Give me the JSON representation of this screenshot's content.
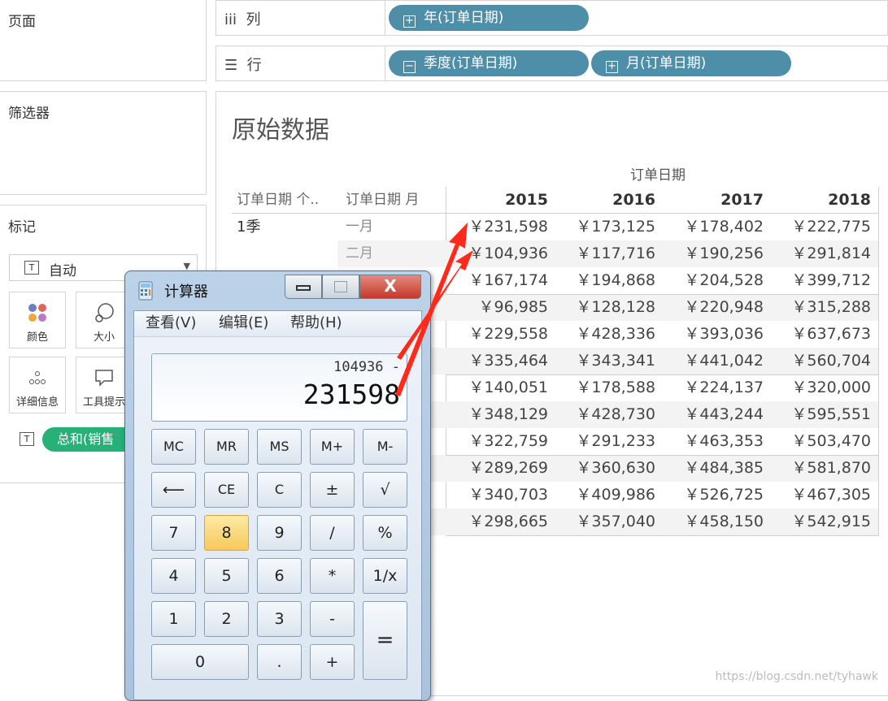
{
  "left": {
    "pages_title": "页面",
    "filters_title": "筛选器",
    "marks": {
      "title": "标记",
      "type_select": "自动",
      "cards": [
        {
          "label": "颜色",
          "icon": "color-dots-icon"
        },
        {
          "label": "大小",
          "icon": "size-icon"
        },
        {
          "label": "详细信息",
          "icon": "detail-icon"
        },
        {
          "label": "工具提示",
          "icon": "tooltip-icon"
        }
      ],
      "pill": "总和(销售",
      "pill_color": "#27b078"
    }
  },
  "shelves": {
    "columns": {
      "label": "列",
      "pills": [
        "年(订单日期)"
      ]
    },
    "rows": {
      "label": "行",
      "pills": [
        "季度(订单日期)",
        "月(订单日期)"
      ]
    },
    "pill_color": "#4e8ea8"
  },
  "sheet": {
    "title": "原始数据",
    "col_group_header": "订单日期",
    "row_headers": [
      "订单日期 个..",
      "订单日期 月"
    ],
    "years": [
      "2015",
      "2016",
      "2017",
      "2018"
    ],
    "quarter_label": "1季",
    "months": [
      "一月",
      "二月"
    ],
    "rows": [
      [
        "￥231,598",
        "￥173,125",
        "￥178,402",
        "￥222,775"
      ],
      [
        "￥104,936",
        "￥117,716",
        "￥190,256",
        "￥291,814"
      ],
      [
        "￥167,174",
        "￥194,868",
        "￥204,528",
        "￥399,712"
      ],
      [
        "￥96,985",
        "￥128,128",
        "￥220,948",
        "￥315,288"
      ],
      [
        "￥229,558",
        "￥428,336",
        "￥393,036",
        "￥637,673"
      ],
      [
        "￥335,464",
        "￥343,341",
        "￥441,042",
        "￥560,704"
      ],
      [
        "￥140,051",
        "￥178,588",
        "￥224,137",
        "￥320,000"
      ],
      [
        "￥348,129",
        "￥428,730",
        "￥443,244",
        "￥595,551"
      ],
      [
        "￥322,759",
        "￥291,233",
        "￥463,353",
        "￥503,470"
      ],
      [
        "￥289,269",
        "￥360,630",
        "￥484,385",
        "￥581,870"
      ],
      [
        "￥340,703",
        "￥409,986",
        "￥526,725",
        "￥467,305"
      ],
      [
        "￥298,665",
        "￥357,040",
        "￥458,150",
        "￥542,915"
      ]
    ]
  },
  "calculator": {
    "title": "计算器",
    "menu": [
      "查看(V)",
      "编辑(E)",
      "帮助(H)"
    ],
    "expression": "104936 -",
    "value": "231598",
    "keys": [
      "MC",
      "MR",
      "MS",
      "M+",
      "M-",
      "⟵",
      "CE",
      "C",
      "±",
      "√",
      "7",
      "8",
      "9",
      "/",
      "%",
      "4",
      "5",
      "6",
      "*",
      "1/x",
      "1",
      "2",
      "3",
      "-",
      "=",
      "0",
      ".",
      "+"
    ]
  },
  "annotation_color": "#ff2a1a",
  "watermark": "https://blog.csdn.net/tyhawk"
}
